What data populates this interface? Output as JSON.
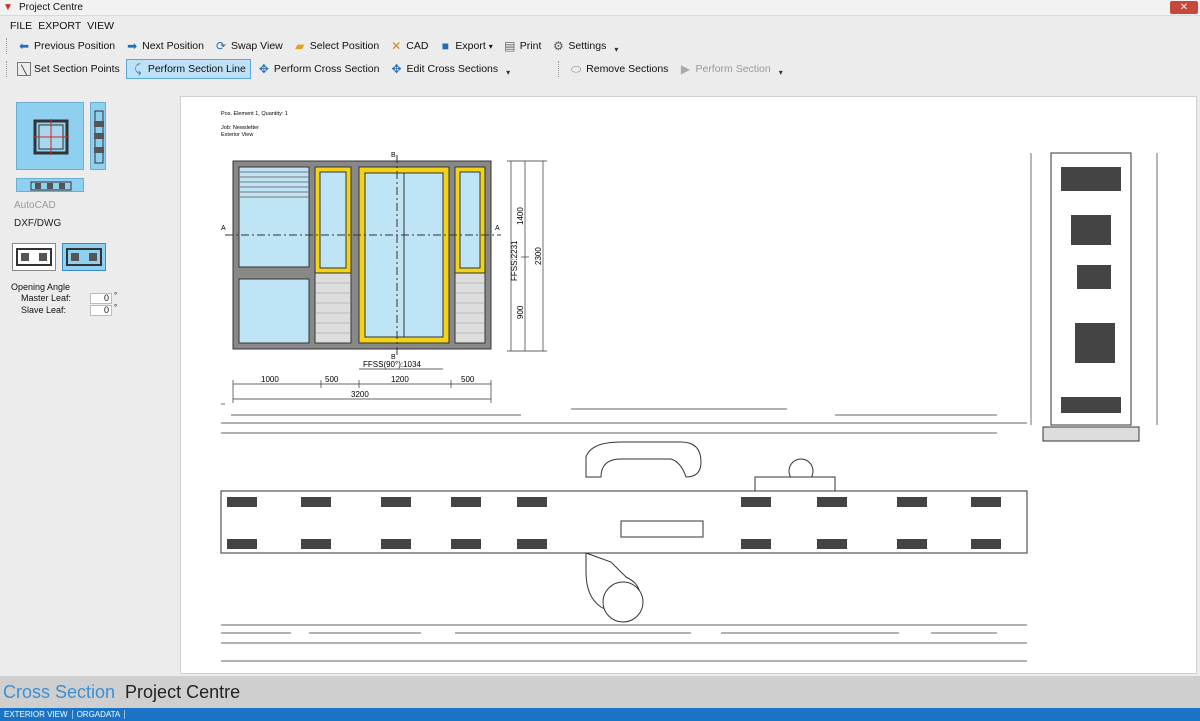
{
  "window": {
    "title": "Project Centre",
    "close": "✕"
  },
  "menu": [
    "FILE",
    "EXPORT",
    "VIEW"
  ],
  "toolbar1": [
    {
      "label": "Previous Position",
      "icon": "arrow-left-icon"
    },
    {
      "label": "Next Position",
      "icon": "arrow-right-icon"
    },
    {
      "label": "Swap View",
      "icon": "swap-icon"
    },
    {
      "label": "Select Position",
      "icon": "folder-icon"
    },
    {
      "label": "CAD",
      "icon": "cad-icon"
    },
    {
      "label": "Export",
      "icon": "floppy-icon"
    },
    {
      "label": "Print",
      "icon": "printer-icon"
    },
    {
      "label": "Settings",
      "icon": "gear-icon"
    }
  ],
  "toolbar2": [
    {
      "label": "Set Section Points",
      "icon": "section-points-icon"
    },
    {
      "label": "Perform Section Line",
      "icon": "section-line-icon",
      "active": true
    },
    {
      "label": "Perform Cross Section",
      "icon": "move-icon"
    },
    {
      "label": "Edit Cross Sections",
      "icon": "move-icon"
    },
    {
      "label": "Remove Sections",
      "icon": "eraser-icon"
    },
    {
      "label": "Perform Section",
      "icon": "play-icon",
      "disabled": true
    }
  ],
  "left_panel": {
    "autocad": "AutoCAD",
    "dxf": "DXF/DWG",
    "opening_angle": "Opening Angle",
    "master_leaf_label": "Master Leaf:",
    "master_leaf_value": "0",
    "slave_leaf_label": "Slave Leaf:",
    "slave_leaf_value": "0",
    "degree": "°"
  },
  "drawing": {
    "pos_text": "Pos. Element 1, Quantity: 1",
    "job_text": "Job: Newsletter",
    "view_text": "Exterior View",
    "section_a": "A",
    "section_b": "B",
    "ffss_vertical": "FFSS:2231",
    "ffss_horizontal": "FFSS(90°):1034",
    "dim_1400": "1400",
    "dim_2300": "2300",
    "dim_900": "900",
    "dim_1000": "1000",
    "dim_500a": "500",
    "dim_1200": "1200",
    "dim_500b": "500",
    "dim_3200": "3200"
  },
  "footer": {
    "tab_active": "Cross Section",
    "tab_inactive": "Project Centre"
  },
  "status": [
    "EXTERIOR VIEW",
    "ORGADATA"
  ],
  "colors": {
    "accent": "#3d8fd1",
    "status_bar": "#1b73c5",
    "frame_yellow": "#f2d31a",
    "glass": "#bfe4f6"
  }
}
